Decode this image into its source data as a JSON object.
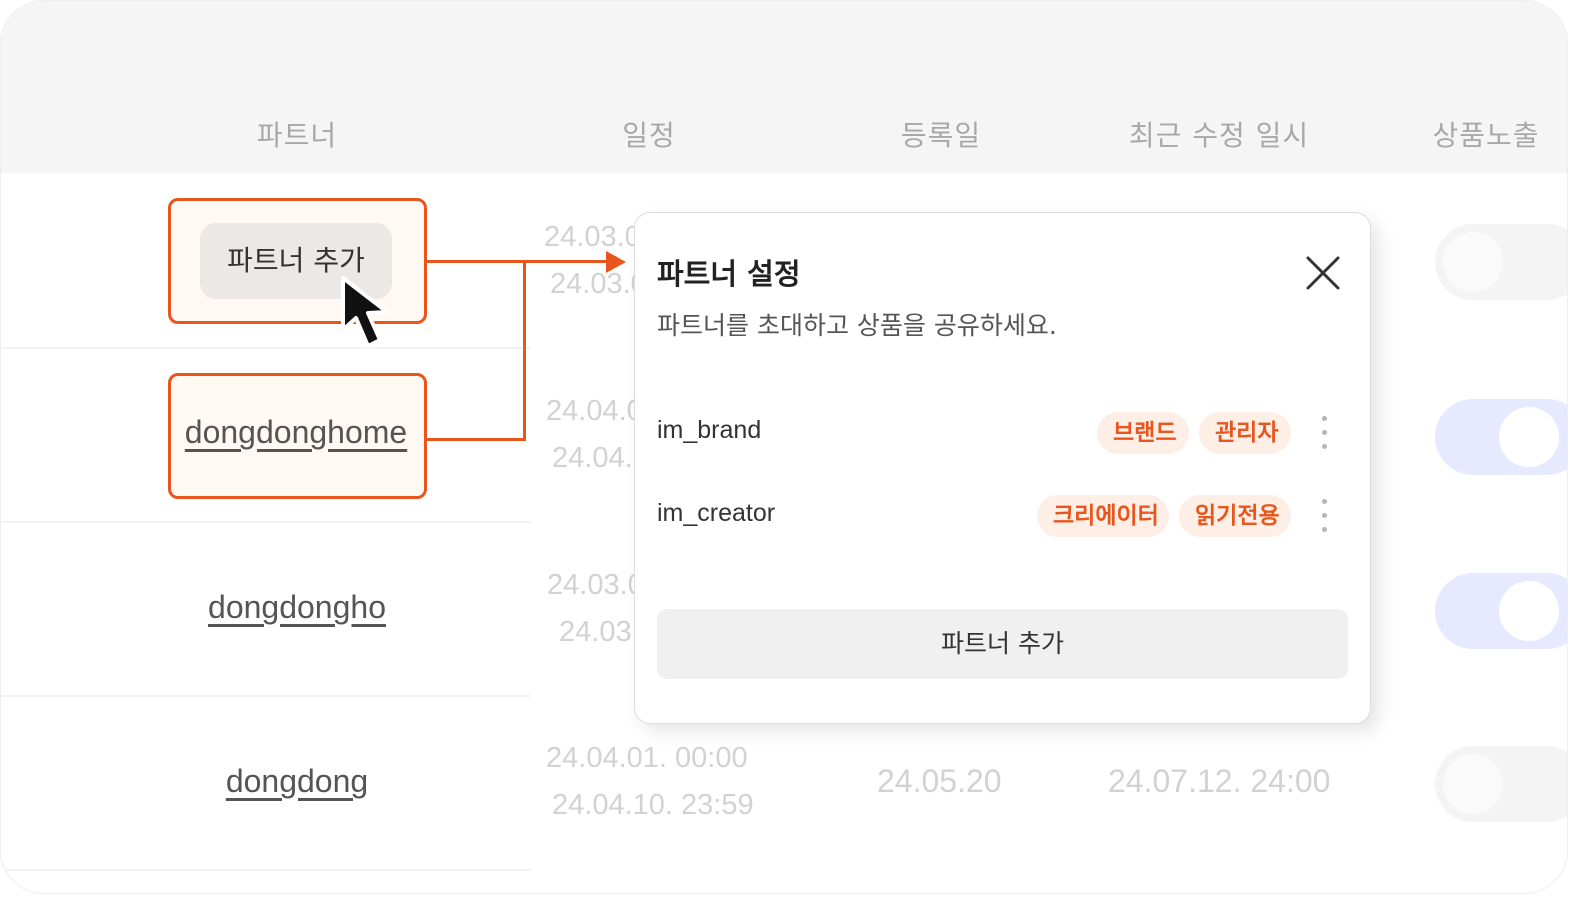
{
  "table": {
    "headers": [
      "파트너",
      "일정",
      "등록일",
      "최근 수정 일시",
      "상품노출"
    ],
    "rows": [
      {
        "partner": "",
        "schedule_start": "24.03.0",
        "schedule_end": "24.03.0",
        "toggle": "off"
      },
      {
        "partner": "dongdonghome",
        "schedule_start": "24.04.0",
        "schedule_end": "24.04.",
        "toggle": "on"
      },
      {
        "partner": "dongdongho",
        "schedule_start": "24.03.0",
        "schedule_end": "24.03.",
        "toggle": "on"
      },
      {
        "partner": "dongdong",
        "schedule_start": "24.04.01. 00:00",
        "schedule_end": "24.04.10. 23:59",
        "registered": "24.05.20",
        "modified": "24.07.12. 24:00",
        "toggle": "off"
      }
    ]
  },
  "callouts": {
    "add_partner_label": "파트너 추가",
    "partner_name": "dongdonghome"
  },
  "modal": {
    "title": "파트너 설정",
    "subtitle": "파트너를 초대하고 상품을 공유하세요.",
    "members": [
      {
        "name": "im_brand",
        "tags": [
          "브랜드",
          "관리자"
        ]
      },
      {
        "name": "im_creator",
        "tags": [
          "크리에이터",
          "읽기전용"
        ]
      }
    ],
    "add_button": "파트너 추가"
  },
  "colors": {
    "accent": "#e8561e",
    "tag_bg": "#fdeee6",
    "toggle_on": "#e6e9ff"
  },
  "icons": {
    "close": "close-icon",
    "more": "kebab-icon",
    "cursor": "cursor-arrow-icon"
  }
}
